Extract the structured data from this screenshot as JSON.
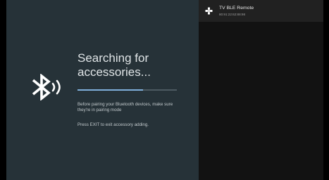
{
  "search_panel": {
    "title": "Searching for accessories...",
    "progress_fraction": 0.66,
    "hint": "Before pairing your Bluetooth devices, make sure they're in pairing mode",
    "exit_hint": "Press EXIT to exit accessory adding."
  },
  "devices": [
    {
      "name": "TV BLE Remote",
      "address": "80:91:22:62:88:98",
      "icon": "gamepad-icon"
    }
  ],
  "icons": {
    "main": "bluetooth-searching-icon"
  },
  "colors": {
    "left_panel_bg": "#263238",
    "right_panel_bg": "#121212",
    "device_row_bg": "#212121",
    "progress_accent": "#7fb0dc"
  }
}
